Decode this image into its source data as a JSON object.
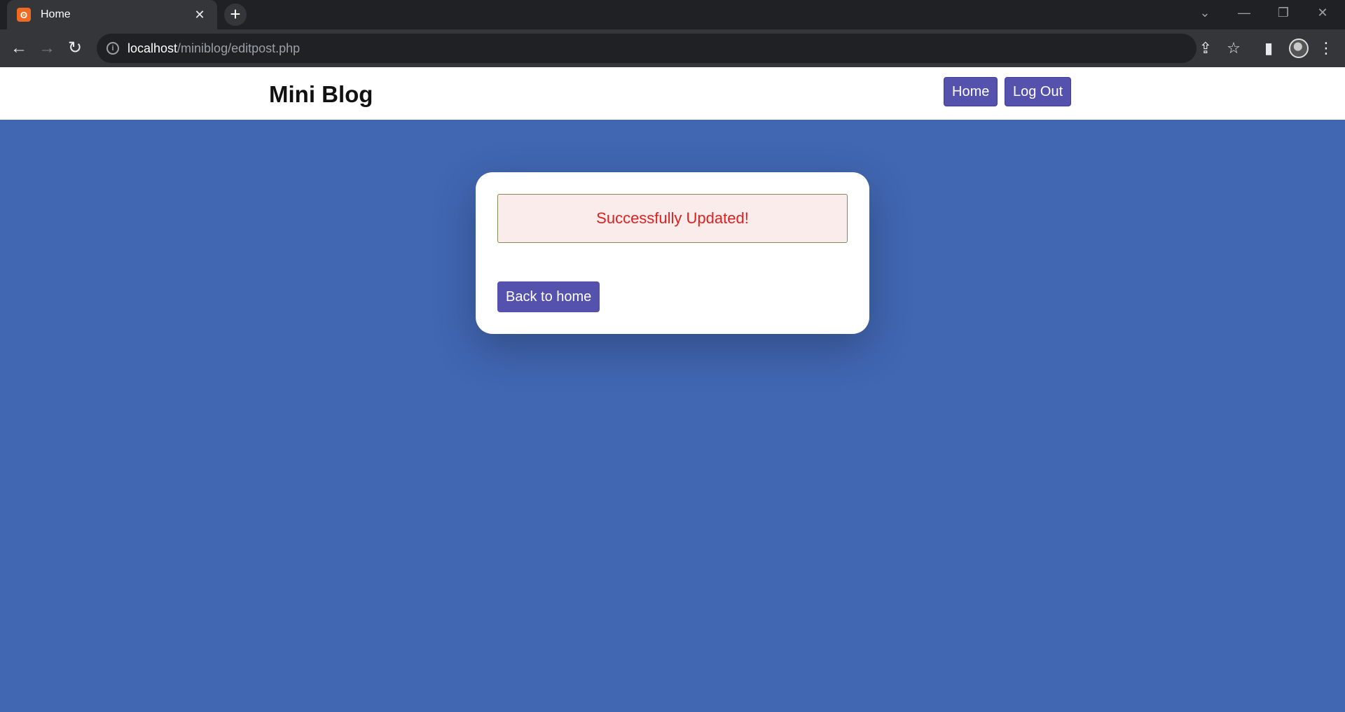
{
  "browser": {
    "tab_title": "Home",
    "tab_close": "✕",
    "new_tab": "+",
    "url_host": "localhost",
    "url_path": "/miniblog/editpost.php"
  },
  "header": {
    "brand": "Mini Blog",
    "nav": [
      {
        "label": "Home"
      },
      {
        "label": "Log Out"
      }
    ]
  },
  "main": {
    "alert_message": "Successfully Updated!",
    "back_button": "Back to home"
  },
  "colors": {
    "page_background": "#4166b2",
    "button": "#5552ae",
    "alert_text": "#e02020",
    "alert_background": "#f9eceb"
  }
}
